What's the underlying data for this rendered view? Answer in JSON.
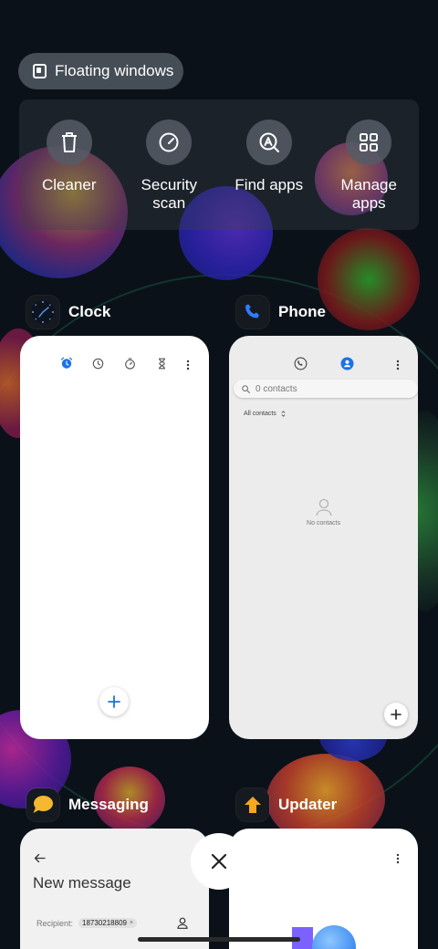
{
  "floating_windows": {
    "label": "Floating windows"
  },
  "quick_actions": [
    {
      "label": "Cleaner",
      "icon": "trash-icon"
    },
    {
      "label": "Security\nscan",
      "icon": "gauge-icon"
    },
    {
      "label": "Find apps",
      "icon": "find-apps-icon"
    },
    {
      "label": "Manage\napps",
      "icon": "grid-icon"
    }
  ],
  "apps": {
    "clock": {
      "name": "Clock",
      "icon": "clock-icon"
    },
    "phone": {
      "name": "Phone",
      "icon": "phone-icon",
      "search_placeholder": "0 contacts",
      "filter_label": "All contacts",
      "empty_text": "No contacts"
    },
    "messaging": {
      "name": "Messaging",
      "icon": "message-bubble-icon",
      "title": "New message",
      "recipient_label": "Recipient:",
      "recipient_chip": "18730218809"
    },
    "updater": {
      "name": "Updater",
      "icon": "up-arrow-icon"
    }
  },
  "colors": {
    "accent_blue": "#1a73e8",
    "messaging_yellow": "#f5b82e",
    "updater_orange": "#f5a623"
  }
}
